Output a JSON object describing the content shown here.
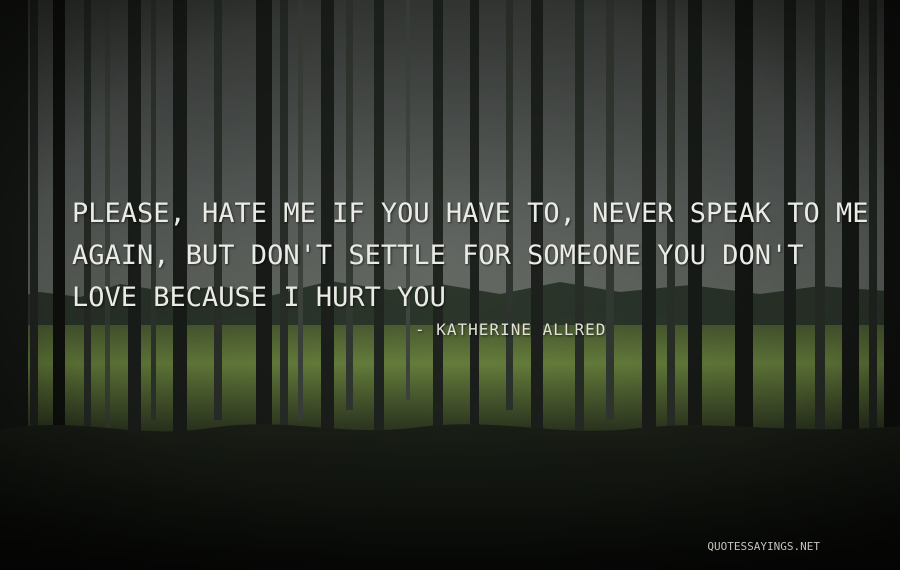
{
  "quote": {
    "text": "Please, hate me if you have to, never speak to me again, but don't settle for someone you don't love because I hurt you",
    "author": "- Katherine Allred"
  },
  "watermark": {
    "text": "QUOTESSAYINGS.NET"
  },
  "colors": {
    "text": "#ebebe6",
    "background_dark": "#121512",
    "field_green": "#6f8a3f",
    "sky_gray": "#5d625f"
  }
}
